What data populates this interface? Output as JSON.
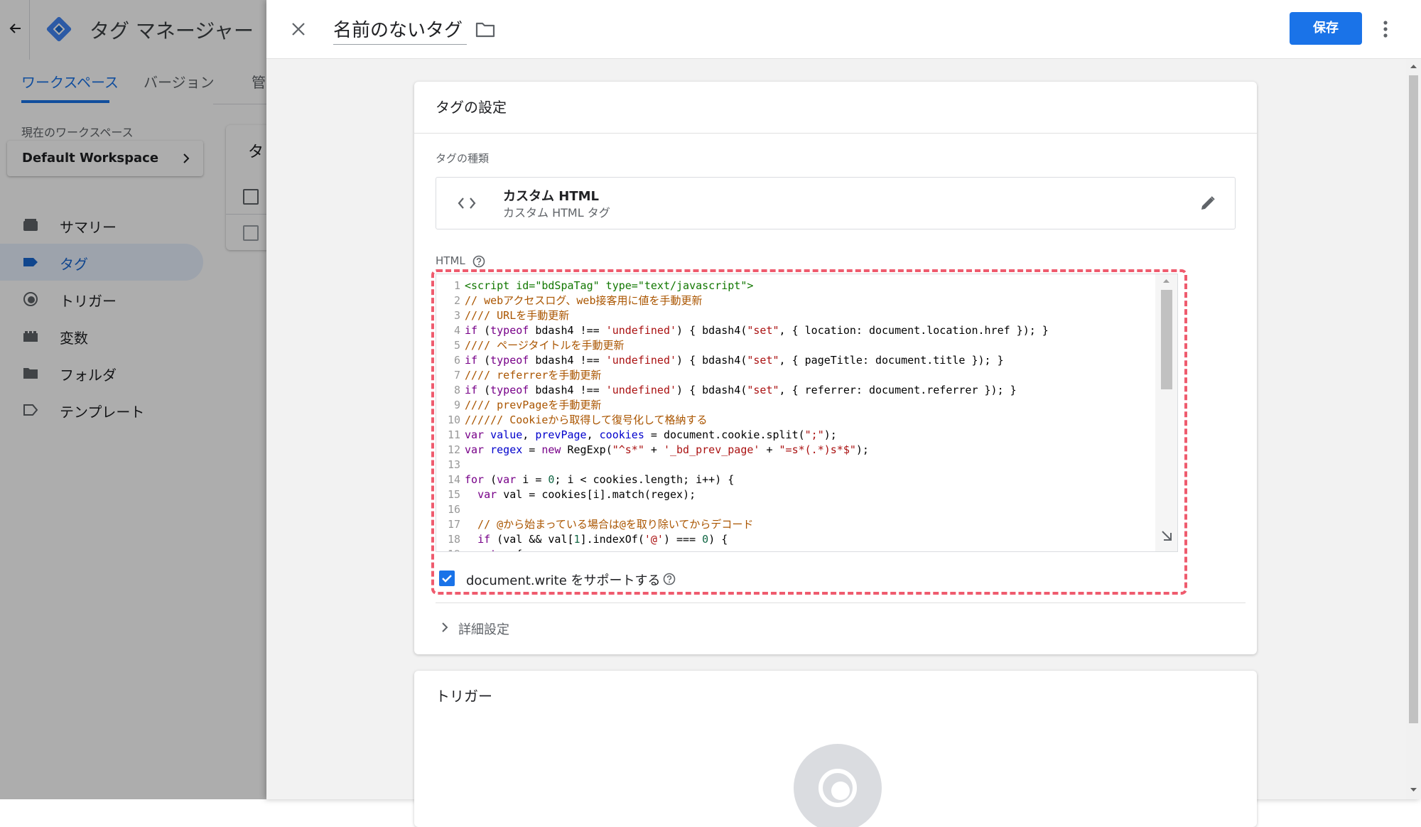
{
  "app": {
    "back_icon": "arrow-left-icon",
    "logo_icon": "gtm-diamond-icon",
    "title": "タグ マネージャー",
    "tabs": [
      {
        "label": "ワークスペース",
        "active": true
      },
      {
        "label": "バージョン"
      },
      {
        "label": "管"
      }
    ],
    "workspace": {
      "caption": "現在のワークスペース",
      "name": "Default Workspace"
    },
    "sidebar": [
      {
        "label": "サマリー",
        "icon": "summary-icon"
      },
      {
        "label": "タグ",
        "icon": "tag-icon",
        "active": true
      },
      {
        "label": "トリガー",
        "icon": "trigger-icon"
      },
      {
        "label": "変数",
        "icon": "variable-icon"
      },
      {
        "label": "フォルダ",
        "icon": "folder-icon"
      },
      {
        "label": "テンプレート",
        "icon": "template-icon"
      }
    ],
    "partial_list_header": "タ"
  },
  "editor": {
    "tag_name": "名前のないタグ",
    "save_label": "保存",
    "config": {
      "title": "タグの設定",
      "type_caption": "タグの種類",
      "type_name": "カスタム HTML",
      "type_sub": "カスタム HTML タグ",
      "html_label": "HTML",
      "code_lines": [
        "<script id=\"bdSpaTag\" type=\"text/javascript\">",
        "// webアクセスログ、web接客用に値を手動更新",
        "//// URLを手動更新",
        "if (typeof bdash4 !== 'undefined') { bdash4(\"set\", { location: document.location.href }); }",
        "//// ページタイトルを手動更新",
        "if (typeof bdash4 !== 'undefined') { bdash4(\"set\", { pageTitle: document.title }); }",
        "//// referrerを手動更新",
        "if (typeof bdash4 !== 'undefined') { bdash4(\"set\", { referrer: document.referrer }); }",
        "//// prevPageを手動更新",
        "////// Cookieから取得して復号化して格納する",
        "var value, prevPage, cookies = document.cookie.split(\";\");",
        "var regex = new RegExp(\"^s*\" + '_bd_prev_page' + \"=s*(.*)s*$\");",
        "",
        "for (var i = 0; i < cookies.length; i++) {",
        "  var val = cookies[i].match(regex);",
        "",
        "  // @から始まっている場合は@を取り除いてからデコード",
        "  if (val && val[1].indexOf('@') === 0) {",
        "    try {"
      ],
      "docwrite_label": "document.write をサポートする",
      "docwrite_checked": true,
      "advanced_label": "詳細設定"
    },
    "trigger": {
      "title": "トリガー"
    }
  }
}
